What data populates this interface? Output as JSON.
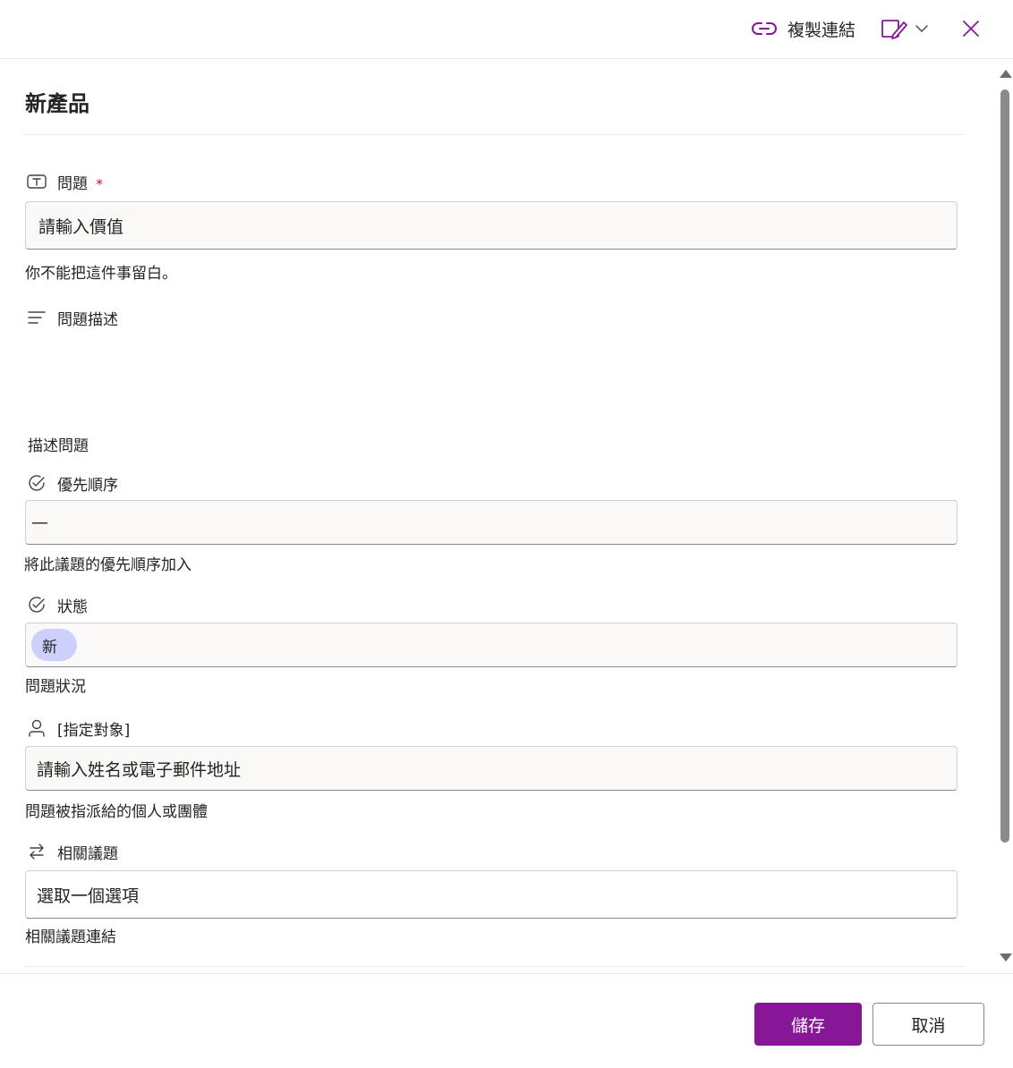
{
  "header": {
    "copy_link_label": "複製連結",
    "icons": {
      "link": "link-icon",
      "edit_form": "edit-form-icon",
      "chevron": "chevron-down-icon",
      "close": "close-icon"
    }
  },
  "form": {
    "title": "新產品",
    "fields": {
      "issue": {
        "icon": "text-field-icon",
        "label": "問題",
        "required_mark": "*",
        "value": "請輸入價值",
        "helper": "你不能把這件事留白。"
      },
      "description": {
        "icon": "multiline-text-icon",
        "label": "問題描述",
        "helper": "描述問題"
      },
      "priority": {
        "icon": "choice-check-icon",
        "label": "優先順序",
        "value": "—",
        "helper": "將此議題的優先順序加入"
      },
      "status": {
        "icon": "choice-check-icon",
        "label": "狀態",
        "value": "新",
        "helper": "問題狀況"
      },
      "assigned_to": {
        "icon": "person-icon",
        "label": "[指定對象]",
        "placeholder": "請輸入姓名或電子郵件地址",
        "helper": "問題被指派給的個人或團體"
      },
      "related_issues": {
        "icon": "arrows-swap-icon",
        "label": "相關議題",
        "placeholder": "選取一個選項",
        "helper": "相關議題連結"
      }
    }
  },
  "footer": {
    "save_label": "儲存",
    "cancel_label": "取消"
  },
  "colors": {
    "accent": "#881798",
    "status_pill": "#cdd0fb",
    "required": "#c50f1f",
    "field_bg": "#faf9f8"
  }
}
